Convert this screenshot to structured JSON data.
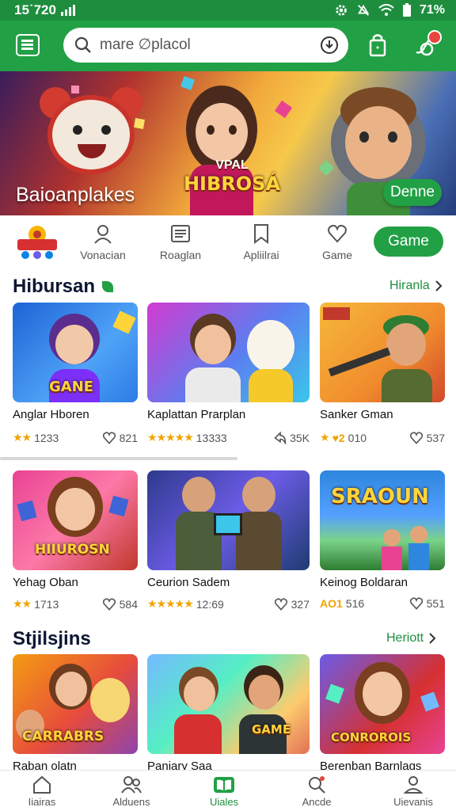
{
  "status_bar": {
    "time": "15˙720",
    "battery": "71%"
  },
  "search": {
    "placeholder": "mare ∅placol"
  },
  "banner": {
    "title": "Baioanplakes",
    "logo_line1": "VPAL",
    "logo_line2": "HIBROSÁ",
    "button": "Denne"
  },
  "categories": {
    "items": [
      {
        "label": "Vonacian",
        "icon": "person-icon"
      },
      {
        "label": "Roaglan",
        "icon": "list-icon"
      },
      {
        "label": "Apliilrai",
        "icon": "bookmark-icon"
      },
      {
        "label": "Game",
        "icon": "heart-icon"
      }
    ],
    "game_button": "Game"
  },
  "section1": {
    "title": "Hibursan",
    "link": "Hiranla",
    "row1": [
      {
        "name": "Anglar Hboren",
        "rating": "1233",
        "likes": "821",
        "image_label": "GANE"
      },
      {
        "name": "Kaplattan Prarplan",
        "rating": "13333",
        "likes": "35K",
        "image_label": ""
      },
      {
        "name": "Sanker Gman",
        "rating": "010",
        "likes": "537",
        "image_label": ""
      }
    ],
    "row2": [
      {
        "name": "Yehag Oban",
        "rating": "1713",
        "likes": "584",
        "image_label": "HIIUROSN"
      },
      {
        "name": "Ceurion Sadem",
        "rating": "12:69",
        "likes": "327",
        "image_label": ""
      },
      {
        "name": "Keinog Boldaran",
        "rating": "516",
        "likes": "551",
        "image_label": "SRAOUN"
      }
    ]
  },
  "section2": {
    "title": "Stjilsjins",
    "link": "Heriott",
    "cards": [
      {
        "name": "Raban olatn",
        "image_label": "CARRABRS"
      },
      {
        "name": "Paniary Saa",
        "image_label": "GAME"
      },
      {
        "name": "Berenban Barnlags",
        "image_label": "CONROROIS"
      }
    ]
  },
  "bottom_nav": [
    {
      "label": "Iiairas",
      "icon": "home-icon"
    },
    {
      "label": "Alduens",
      "icon": "people-icon"
    },
    {
      "label": "Uiales",
      "icon": "book-icon",
      "active": true
    },
    {
      "label": "Ancde",
      "icon": "search-icon"
    },
    {
      "label": "Uievanis",
      "icon": "profile-icon"
    }
  ],
  "colors": {
    "brand": "#22a045",
    "status_bar": "#1e8e3e",
    "star": "#f0a400",
    "title": "#0d1633"
  }
}
